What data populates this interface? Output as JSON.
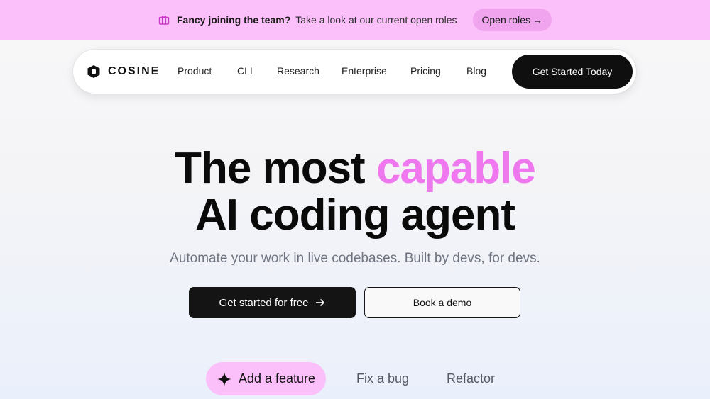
{
  "announcement": {
    "icon": "briefcase-icon",
    "lead": "Fancy joining the team?",
    "text": "Take a look at our current open roles",
    "button_label": "Open roles",
    "button_arrow": "→",
    "background": "#fbbff9"
  },
  "nav": {
    "brand": "COSINE",
    "logo_icon": "cosine-logo-icon",
    "links": [
      "Product",
      "CLI",
      "Research",
      "Enterprise",
      "Pricing",
      "Blog"
    ],
    "cta_label": "Get Started Today"
  },
  "hero": {
    "line1_plain": "The most",
    "line1_accent": "capable",
    "line2": "AI coding agent",
    "accent_color": "#ef78ef",
    "subtitle": "Automate your work in live codebases. Built by devs, for devs.",
    "primary_label": "Get started for free",
    "primary_icon": "arrow-right-icon",
    "secondary_label": "Book a demo"
  },
  "modes": {
    "active_icon": "sparkle-icon",
    "tabs": [
      "Add a feature",
      "Fix a bug",
      "Refactor"
    ],
    "active_index": 0
  }
}
